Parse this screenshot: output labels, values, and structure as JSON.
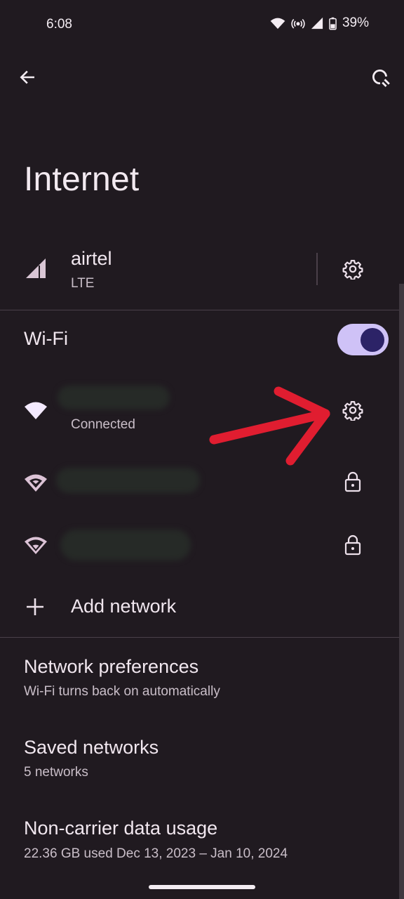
{
  "status_bar": {
    "time": "6:08",
    "battery": "39%"
  },
  "page": {
    "title": "Internet"
  },
  "sim": {
    "carrier": "airtel",
    "type": "LTE"
  },
  "wifi": {
    "label": "Wi-Fi",
    "enabled": true,
    "networks": [
      {
        "status": "Connected"
      }
    ],
    "add_network_label": "Add network"
  },
  "settings": {
    "network_preferences": {
      "title": "Network preferences",
      "subtitle": "Wi-Fi turns back on automatically"
    },
    "saved_networks": {
      "title": "Saved networks",
      "subtitle": "5 networks"
    },
    "data_usage": {
      "title": "Non-carrier data usage",
      "subtitle": "22.36 GB used Dec 13, 2023 – Jan 10, 2024"
    }
  },
  "colors": {
    "background": "#201a20",
    "toggle_track": "#cfc2f7",
    "toggle_thumb": "#2c2367",
    "annotation_arrow": "#e01d30"
  },
  "icons": {
    "back": "arrow-left-icon",
    "help": "help-search-icon",
    "sim_signal": "cell-signal-icon",
    "settings": "gear-icon",
    "wifi": "wifi-icon",
    "lock": "lock-icon",
    "add": "plus-icon"
  }
}
